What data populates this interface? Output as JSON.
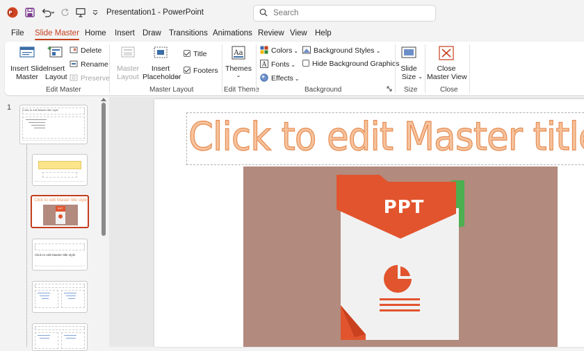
{
  "window": {
    "title": "Presentation1  -  PowerPoint"
  },
  "search": {
    "placeholder": "Search"
  },
  "tabs": [
    "File",
    "Slide Master",
    "Home",
    "Insert",
    "Draw",
    "Transitions",
    "Animations",
    "Review",
    "View",
    "Help"
  ],
  "active_tab": "Slide Master",
  "ribbon": {
    "edit_master": {
      "label": "Edit Master",
      "insert_slide_master": "Insert Slide\nMaster",
      "insert_layout": "Insert\nLayout",
      "delete": "Delete",
      "rename": "Rename",
      "preserve": "Preserve"
    },
    "master_layout": {
      "label": "Master Layout",
      "master_layout_btn": "Master\nLayout",
      "insert_placeholder": "Insert\nPlaceholder",
      "title": "Title",
      "title_checked": true,
      "footers": "Footers",
      "footers_checked": true
    },
    "edit_theme": {
      "label": "Edit Theme",
      "themes": "Themes"
    },
    "background": {
      "label": "Background",
      "colors": "Colors",
      "fonts": "Fonts",
      "effects": "Effects",
      "background_styles": "Background Styles",
      "hide_background_graphics": "Hide Background Graphics",
      "hide_checked": false
    },
    "size": {
      "label": "Size",
      "slide_size": "Slide\nSize"
    },
    "close": {
      "label": "Close",
      "close_master_view": "Close\nMaster View"
    }
  },
  "thumbnails": {
    "slide_number": "1",
    "master_title_small": "Click to edit Master title style",
    "layout4_title": "Click to edit Master title style",
    "selected_title": "Click to edit Master title style",
    "selected_badge": "PPT"
  },
  "slide": {
    "title_placeholder": "Click to edit Master title style",
    "picture_label": "PPT"
  },
  "colors": {
    "accent": "#c43e1c",
    "picture_bg": "#b28a7e",
    "ppt_orange": "#e2542d",
    "ppt_green": "#4caf50",
    "title_fill": "#f6c29c"
  }
}
